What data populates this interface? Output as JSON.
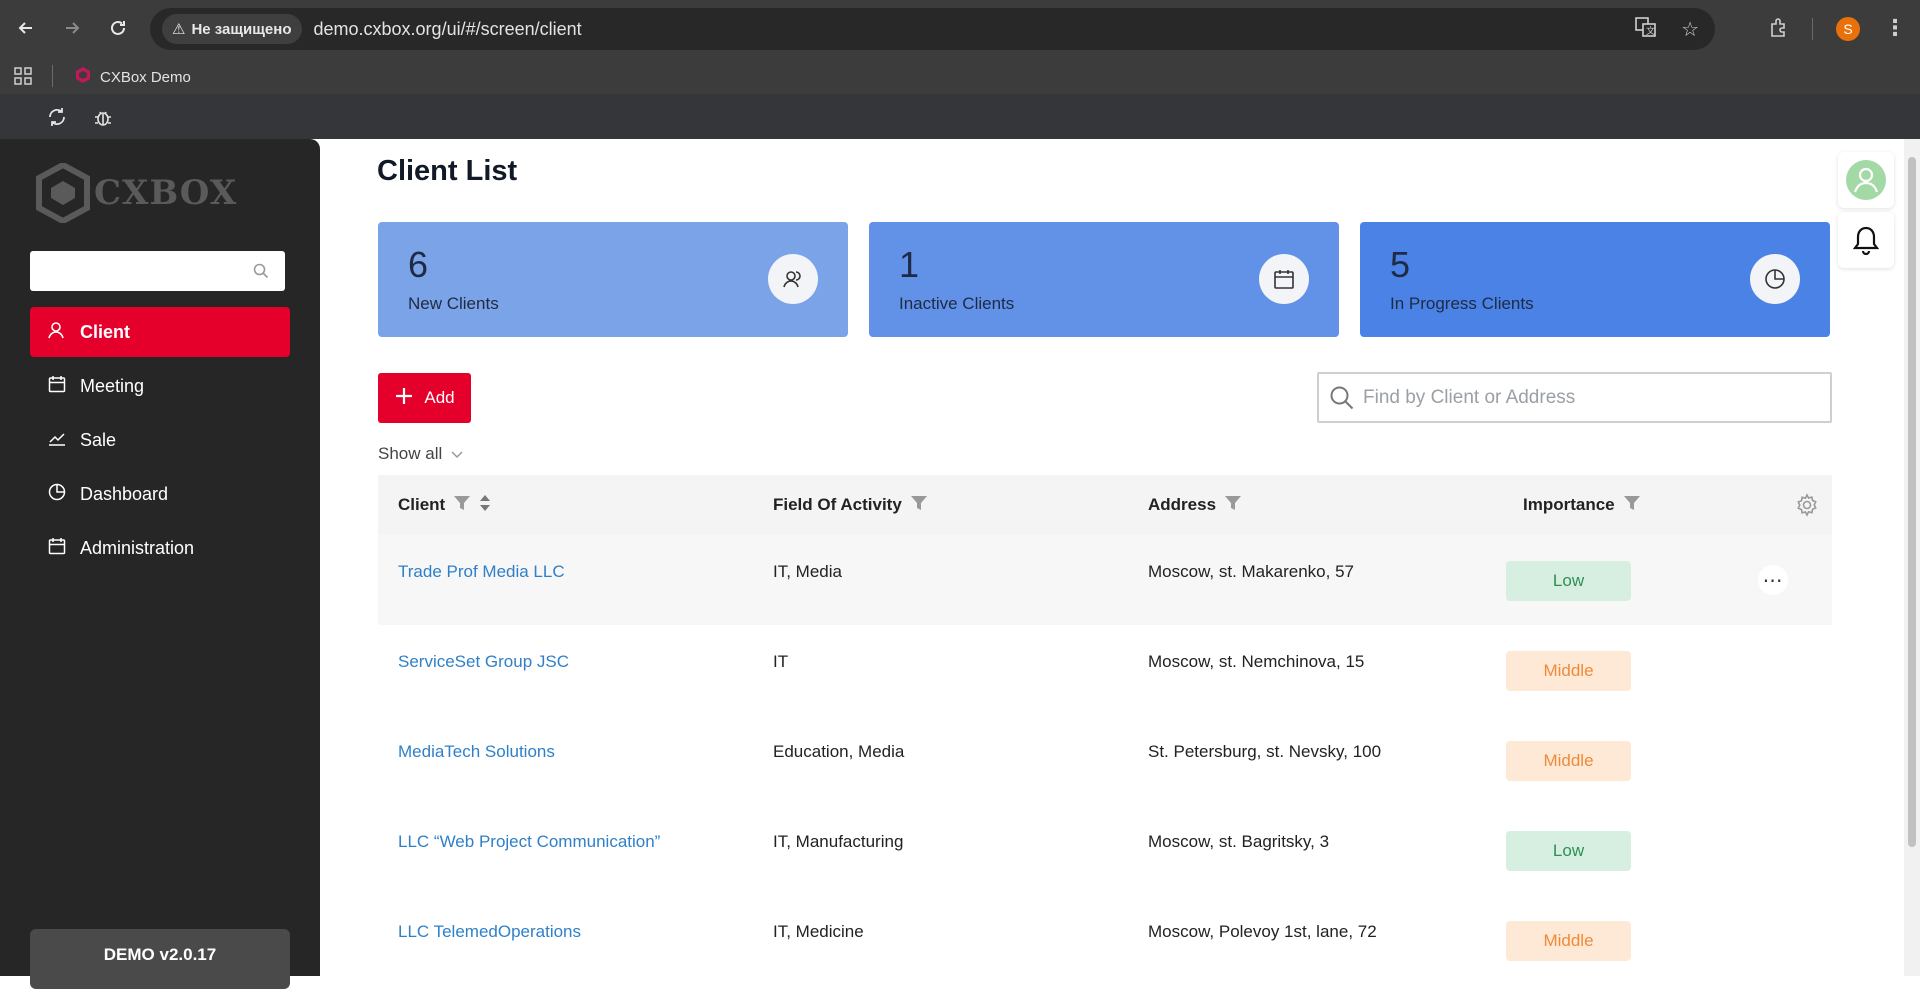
{
  "browser": {
    "security_label": "Не защищено",
    "url": "demo.cxbox.org/ui/#/screen/client",
    "profile_initial": "S",
    "bookmark_label": "CXBox Demo"
  },
  "sidebar": {
    "logo_text": "CXBOX",
    "search_placeholder": "",
    "items": [
      {
        "label": "Client",
        "icon": "user-icon",
        "active": true
      },
      {
        "label": "Meeting",
        "icon": "calendar-icon",
        "active": false
      },
      {
        "label": "Sale",
        "icon": "chart-line-icon",
        "active": false
      },
      {
        "label": "Dashboard",
        "icon": "pie-chart-icon",
        "active": false
      },
      {
        "label": "Administration",
        "icon": "calendar-icon",
        "active": false
      }
    ],
    "version": "DEMO v2.0.17"
  },
  "main": {
    "title": "Client List",
    "cards": [
      {
        "number": "6",
        "label": "New Clients",
        "icon": "users-icon",
        "color": "#7ba3e8"
      },
      {
        "number": "1",
        "label": "Inactive Clients",
        "icon": "calendar-icon",
        "color": "#6192e8"
      },
      {
        "number": "5",
        "label": "In Progress Clients",
        "icon": "pie-chart-icon",
        "color": "#4b82e6"
      }
    ],
    "add_label": "Add",
    "find_placeholder": "Find by Client or Address",
    "show_all_label": "Show all",
    "columns": [
      "Client",
      "Field Of Activity",
      "Address",
      "Importance"
    ],
    "rows": [
      {
        "client": "Trade Prof Media LLC",
        "activity": "IT, Media",
        "address": "Moscow, st. Makarenko, 57",
        "importance": "Low"
      },
      {
        "client": "ServiceSet Group JSC",
        "activity": "IT",
        "address": "Moscow, st. Nemchinova, 15",
        "importance": "Middle"
      },
      {
        "client": "MediaTech Solutions",
        "activity": "Education, Media",
        "address": "St. Petersburg, st. Nevsky, 100",
        "importance": "Middle"
      },
      {
        "client": "LLC “Web Project Communication”",
        "activity": "IT, Manufacturing",
        "address": "Moscow, st. Bagritsky, 3",
        "importance": "Low"
      },
      {
        "client": "LLC TelemedOperations",
        "activity": "IT, Medicine",
        "address": "Moscow, Polevoy 1st, lane, 72",
        "importance": "Middle"
      }
    ]
  },
  "colors": {
    "accent": "#e4002b",
    "sidebar_bg": "#262626",
    "link": "#2f80c8"
  }
}
